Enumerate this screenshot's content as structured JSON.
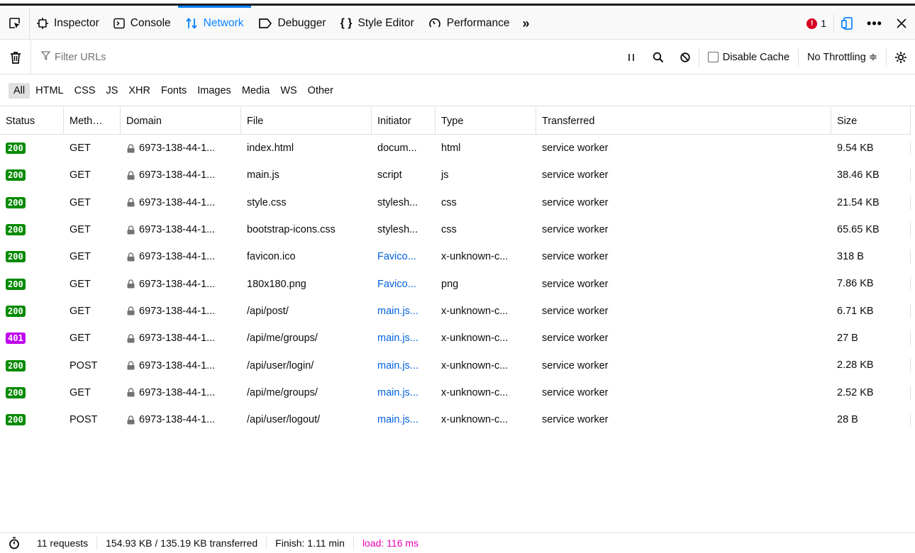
{
  "toolbox": {
    "tabs": [
      {
        "label": "Inspector",
        "icon": "inspector-icon"
      },
      {
        "label": "Console",
        "icon": "console-icon"
      },
      {
        "label": "Network",
        "icon": "network-icon",
        "active": true
      },
      {
        "label": "Debugger",
        "icon": "debugger-icon"
      },
      {
        "label": "Style Editor",
        "icon": "style-editor-icon"
      },
      {
        "label": "Performance",
        "icon": "performance-icon"
      }
    ],
    "more": "»",
    "error_count": "1",
    "accent": "#0a84ff"
  },
  "filterbar": {
    "placeholder": "Filter URLs",
    "disable_cache": "Disable Cache",
    "throttling": "No Throttling ≑"
  },
  "types": [
    "All",
    "HTML",
    "CSS",
    "JS",
    "XHR",
    "Fonts",
    "Images",
    "Media",
    "WS",
    "Other"
  ],
  "columns": {
    "status": "Status",
    "method": "Meth…",
    "domain": "Domain",
    "file": "File",
    "initiator": "Initiator",
    "type": "Type",
    "transferred": "Transferred",
    "size": "Size"
  },
  "requests": [
    {
      "status": "200",
      "method": "GET",
      "domain": "6973-138-44-1...",
      "file": "index.html",
      "initiator": "docum...",
      "type": "html",
      "transferred": "service worker",
      "size": "9.54 KB"
    },
    {
      "status": "200",
      "method": "GET",
      "domain": "6973-138-44-1...",
      "file": "main.js",
      "initiator": "script",
      "type": "js",
      "transferred": "service worker",
      "size": "38.46 KB"
    },
    {
      "status": "200",
      "method": "GET",
      "domain": "6973-138-44-1...",
      "file": "style.css",
      "initiator": "stylesh...",
      "type": "css",
      "transferred": "service worker",
      "size": "21.54 KB"
    },
    {
      "status": "200",
      "method": "GET",
      "domain": "6973-138-44-1...",
      "file": "bootstrap-icons.css",
      "initiator": "stylesh...",
      "type": "css",
      "transferred": "service worker",
      "size": "65.65 KB"
    },
    {
      "status": "200",
      "method": "GET",
      "domain": "6973-138-44-1...",
      "file": "favicon.ico",
      "initiator": "Favico...",
      "type": "x-unknown-c...",
      "transferred": "service worker",
      "size": "318 B"
    },
    {
      "status": "200",
      "method": "GET",
      "domain": "6973-138-44-1...",
      "file": "180x180.png",
      "initiator": "Favico...",
      "type": "png",
      "transferred": "service worker",
      "size": "7.86 KB"
    },
    {
      "status": "200",
      "method": "GET",
      "domain": "6973-138-44-1...",
      "file": "/api/post/",
      "initiator": "main.js...",
      "type": "x-unknown-c...",
      "transferred": "service worker",
      "size": "6.71 KB"
    },
    {
      "status": "401",
      "method": "GET",
      "domain": "6973-138-44-1...",
      "file": "/api/me/groups/",
      "initiator": "main.js...",
      "type": "x-unknown-c...",
      "transferred": "service worker",
      "size": "27 B"
    },
    {
      "status": "200",
      "method": "POST",
      "domain": "6973-138-44-1...",
      "file": "/api/user/login/",
      "initiator": "main.js...",
      "type": "x-unknown-c...",
      "transferred": "service worker",
      "size": "2.28 KB"
    },
    {
      "status": "200",
      "method": "GET",
      "domain": "6973-138-44-1...",
      "file": "/api/me/groups/",
      "initiator": "main.js...",
      "type": "x-unknown-c...",
      "transferred": "service worker",
      "size": "2.52 KB"
    },
    {
      "status": "200",
      "method": "POST",
      "domain": "6973-138-44-1...",
      "file": "/api/user/logout/",
      "initiator": "main.js...",
      "type": "x-unknown-c...",
      "transferred": "service worker",
      "size": "28 B"
    }
  ],
  "status_colors": {
    "200": "#058b00",
    "401": "#c000f0"
  },
  "link_initiators": [
    "Favico...",
    "main.js..."
  ],
  "statusbar": {
    "requests": "11 requests",
    "transferred": "154.93 KB / 135.19 KB transferred",
    "finish": "Finish: 1.11 min",
    "load": "load: 116 ms"
  }
}
